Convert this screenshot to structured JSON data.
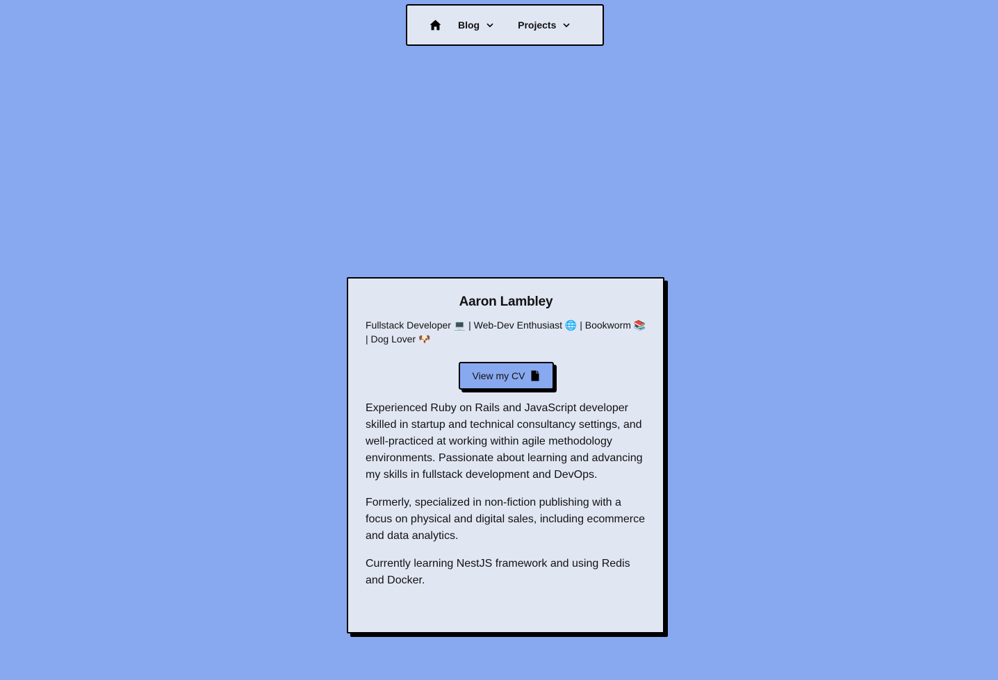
{
  "nav": {
    "home_icon": "home-icon",
    "items": [
      {
        "label": "Blog",
        "icon": "chevron-down-icon"
      },
      {
        "label": "Projects",
        "icon": "chevron-down-icon"
      }
    ]
  },
  "profile": {
    "name": "Aaron Lambley",
    "tagline": "Fullstack Developer 💻 | Web-Dev Enthusiast 🌐 | Bookworm 📚 | Dog Lover 🐶",
    "cv_button_label": "View my CV",
    "cv_button_icon": "document-icon",
    "paragraphs": [
      "Experienced Ruby on Rails and JavaScript developer skilled in startup and technical consultancy settings, and well-practiced at working within agile methodology environments. Passionate about learning and advancing my skills in fullstack development and DevOps.",
      "Formerly, specialized in non-fiction publishing with a focus on physical and digital sales, including ecommerce and data analytics.",
      "Currently learning NestJS framework and using Redis and Docker."
    ]
  },
  "colors": {
    "background": "#88a9ef",
    "panel": "#e1e6f3",
    "border": "#000000"
  }
}
